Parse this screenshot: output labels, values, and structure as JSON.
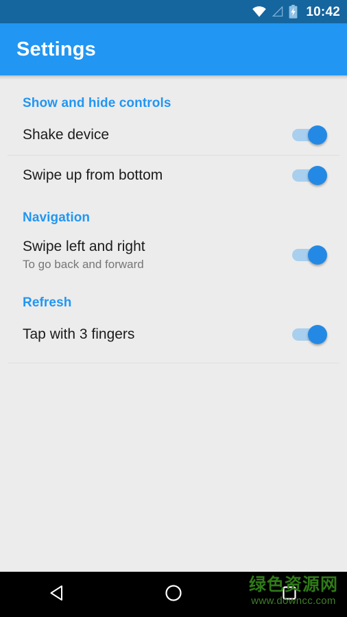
{
  "status_bar": {
    "time": "10:42",
    "icons": [
      {
        "name": "wifi-icon",
        "state": "full"
      },
      {
        "name": "cellular-signal-icon",
        "state": "no-signal"
      },
      {
        "name": "battery-charging-icon",
        "state": "charging"
      }
    ],
    "background_color": "#15659e"
  },
  "app_bar": {
    "title": "Settings",
    "background_color": "#2196f3",
    "text_color": "#ffffff"
  },
  "sections": [
    {
      "header": "Show and hide controls",
      "items": [
        {
          "title": "Shake device",
          "subtitle": "",
          "toggle": {
            "name": "shake-device-switch",
            "on": true
          },
          "divider_after": true
        },
        {
          "title": "Swipe up from bottom",
          "subtitle": "",
          "toggle": {
            "name": "swipe-up-from-bottom-switch",
            "on": true
          },
          "divider_after": false
        }
      ]
    },
    {
      "header": "Navigation",
      "items": [
        {
          "title": "Swipe left and right",
          "subtitle": "To go back and forward",
          "toggle": {
            "name": "swipe-left-right-switch",
            "on": true
          },
          "divider_after": false
        }
      ]
    },
    {
      "header": "Refresh",
      "items": [
        {
          "title": "Tap with 3 fingers",
          "subtitle": "",
          "toggle": {
            "name": "tap-three-fingers-switch",
            "on": true
          },
          "divider_after": true
        }
      ]
    }
  ],
  "nav_bar": {
    "background_color": "#000000",
    "buttons": [
      {
        "name": "back-button",
        "icon": "back-triangle-icon"
      },
      {
        "name": "home-button",
        "icon": "home-circle-icon"
      },
      {
        "name": "recents-button",
        "icon": "recents-square-icon"
      }
    ]
  },
  "watermark": {
    "text_cn": "绿色资源网",
    "text_url": "www.downcc.com",
    "color": "#2f7a17"
  },
  "theme": {
    "accent": "#2196f3",
    "status_bar": "#15659e",
    "page_background": "#ececec",
    "divider": "#dedede",
    "title_text": "#1a1a1a",
    "subtitle_text": "#767676",
    "switch_track_on": "#a9cfee",
    "switch_thumb_on": "#2489e4"
  }
}
